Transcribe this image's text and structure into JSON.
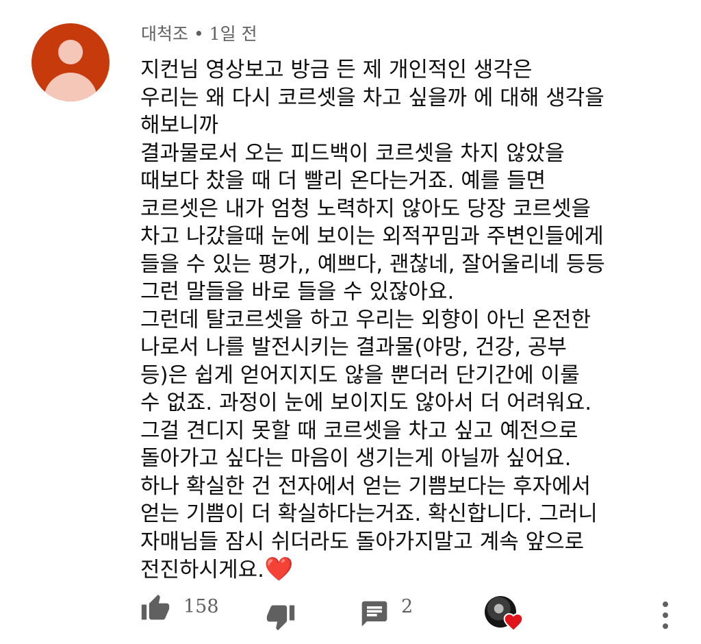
{
  "comment": {
    "author": "대척조",
    "separator": "•",
    "time": "1일 전",
    "lines": [
      "지컨님 영상보고 방금 든 제 개인적인 생각은",
      "우리는 왜 다시 코르셋을 차고 싶을까 에 대해 생각을",
      "해보니까",
      "결과물로서 오는 피드백이 코르셋을 차지 않았을",
      "때보다 찼을 때 더 빨리 온다는거죠. 예를 들면",
      "코르셋은 내가 엄청 노력하지 않아도 당장 코르셋을",
      "차고 나갔을때 눈에 보이는 외적꾸밈과 주변인들에게",
      "들을 수 있는 평가,, 예쁘다, 괜찮네, 잘어울리네 등등",
      "그런 말들을 바로 들을 수 있잖아요.",
      "그런데 탈코르셋을 하고 우리는 외향이 아닌 온전한",
      "나로서 나를 발전시키는 결과물(야망, 건강, 공부",
      "등)은 쉽게 얻어지지도 않을 뿐더러 단기간에 이룰",
      "수 없죠. 과정이 눈에 보이지도 않아서 더 어려워요.",
      "그걸 견디지 못할 때 코르셋을 차고 싶고 예전으로",
      "돌아가고 싶다는 마음이 생기는게 아닐까 싶어요.",
      "하나 확실한 건 전자에서 얻는 기쁨보다는 후자에서",
      "얻는 기쁨이 더 확실하다는거죠. 확신합니다. 그러니",
      "자매님들 잠시 쉬더라도 돌아가지말고 계속 앞으로",
      "전진하시게요."
    ],
    "trailing_emoji": "❤️"
  },
  "actions": {
    "like_count": "158",
    "reply_count": "2"
  },
  "icons": {
    "like": "thumbs-up-icon",
    "dislike": "thumbs-down-icon",
    "reply": "comment-icon",
    "creator_heart": "heart-icon",
    "more": "more-vertical-icon"
  },
  "colors": {
    "avatar_bg": "#c73a0c",
    "heart": "#e0131b",
    "meta_text": "#606060"
  }
}
